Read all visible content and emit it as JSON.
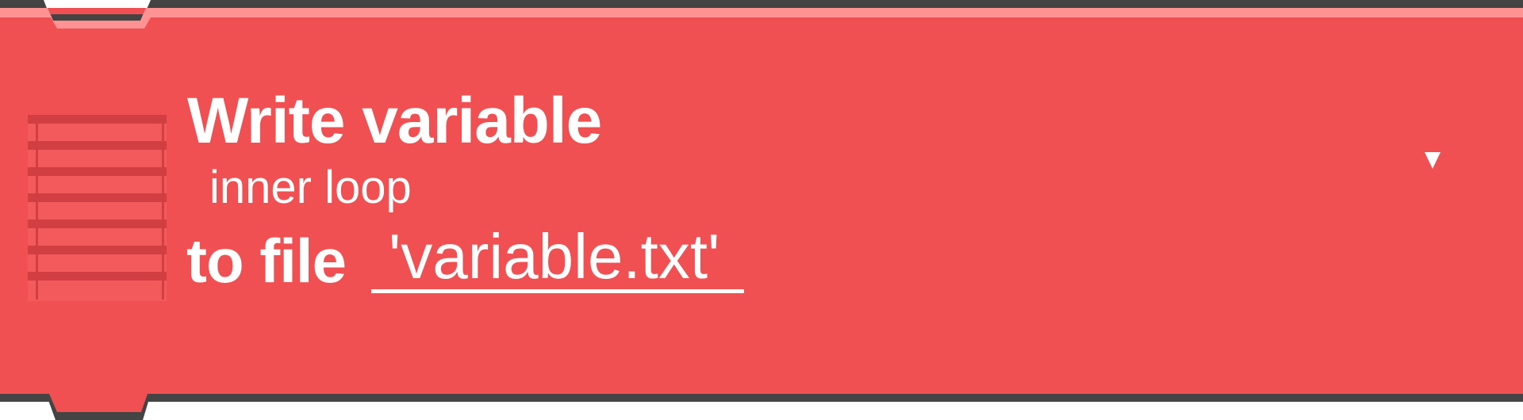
{
  "block": {
    "title": "Write variable",
    "variable_name": "inner loop",
    "to_file_label": "to file",
    "filename": "'variable.txt'",
    "dropdown_icon": "triangle-down-icon",
    "block_icon": "table-grid-icon"
  },
  "colors": {
    "block_fill": "#f15052",
    "highlight": "#ff9393",
    "outline": "#444444",
    "icon_lines": "#d23f42",
    "text": "#ffffff"
  }
}
